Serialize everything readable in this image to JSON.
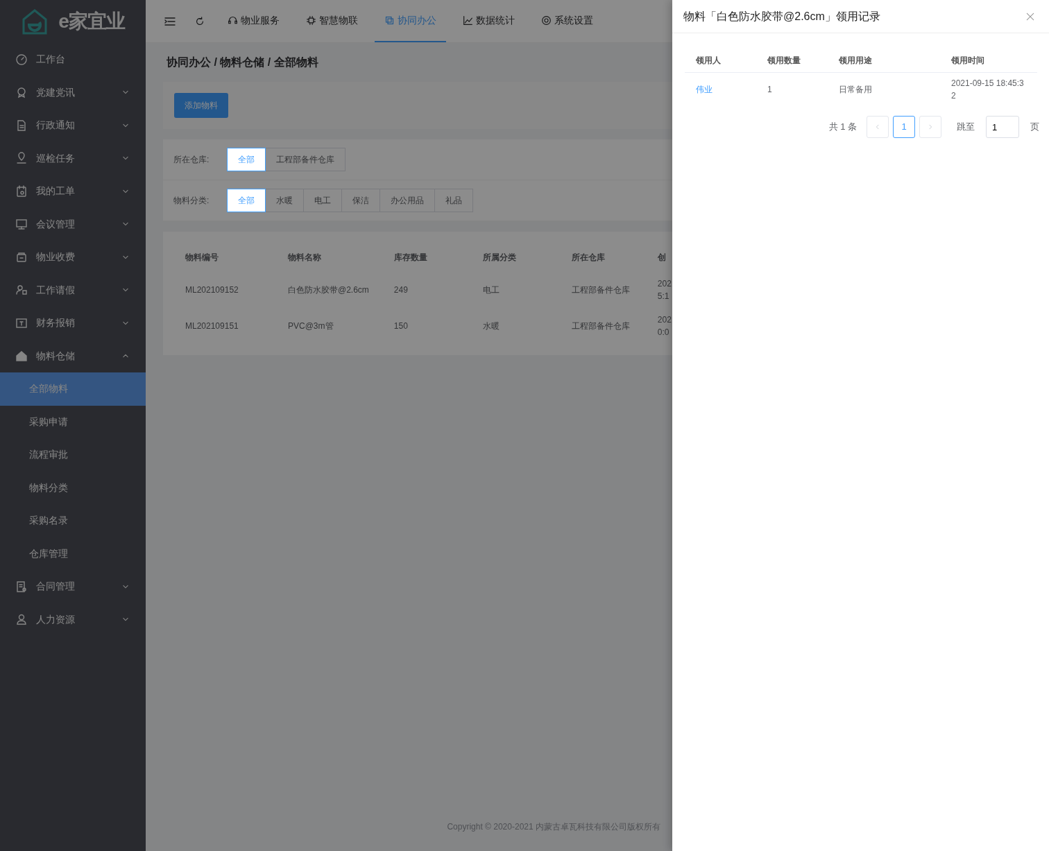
{
  "logo": {
    "text": "e家宜业"
  },
  "top_tabs": [
    {
      "label": "物业服务",
      "selected": false
    },
    {
      "label": "智慧物联",
      "selected": false
    },
    {
      "label": "协同办公",
      "selected": true
    },
    {
      "label": "数据统计",
      "selected": false
    },
    {
      "label": "系统设置",
      "selected": false
    }
  ],
  "sidebar": {
    "items": [
      {
        "label": "工作台",
        "kind": "link"
      },
      {
        "label": "党建党讯",
        "kind": "group",
        "expanded": false
      },
      {
        "label": "行政通知",
        "kind": "group",
        "expanded": false
      },
      {
        "label": "巡检任务",
        "kind": "group",
        "expanded": false
      },
      {
        "label": "我的工单",
        "kind": "group",
        "expanded": false
      },
      {
        "label": "会议管理",
        "kind": "group",
        "expanded": false
      },
      {
        "label": "物业收费",
        "kind": "group",
        "expanded": false
      },
      {
        "label": "工作请假",
        "kind": "group",
        "expanded": false
      },
      {
        "label": "财务报销",
        "kind": "group",
        "expanded": false
      },
      {
        "label": "物料仓储",
        "kind": "group",
        "expanded": true,
        "children": [
          {
            "label": "全部物料",
            "selected": true
          },
          {
            "label": "采购申请",
            "selected": false
          },
          {
            "label": "流程审批",
            "selected": false
          },
          {
            "label": "物料分类",
            "selected": false
          },
          {
            "label": "采购名录",
            "selected": false
          },
          {
            "label": "仓库管理",
            "selected": false
          }
        ]
      },
      {
        "label": "合同管理",
        "kind": "group",
        "expanded": false
      },
      {
        "label": "人力资源",
        "kind": "group",
        "expanded": false
      }
    ]
  },
  "breadcrumb": "协同办公 / 物料仓储 / 全部物料",
  "add_button": "添加物料",
  "filters": [
    {
      "label": "所在仓库:",
      "options": [
        {
          "label": "全部",
          "selected": true
        },
        {
          "label": "工程部备件仓库",
          "selected": false
        }
      ]
    },
    {
      "label": "物料分类:",
      "options": [
        {
          "label": "全部",
          "selected": true
        },
        {
          "label": "水暖",
          "selected": false
        },
        {
          "label": "电工",
          "selected": false
        },
        {
          "label": "保洁",
          "selected": false
        },
        {
          "label": "办公用品",
          "selected": false
        },
        {
          "label": "礼品",
          "selected": false
        }
      ]
    }
  ],
  "table": {
    "columns": [
      "物料编号",
      "物料名称",
      "库存数量",
      "所属分类",
      "所在仓库",
      "创"
    ],
    "rows": [
      [
        "ML202109152",
        "白色防水胶带@2.6cm",
        "249",
        "电工",
        "工程部备件仓库",
        "202\n5:1"
      ],
      [
        "ML202109151",
        "PVC@3m管",
        "150",
        "水暖",
        "工程部备件仓库",
        "202\n0:0"
      ]
    ]
  },
  "footer": "Copyright © 2020-2021 内蒙古卓瓦科技有限公司版权所有",
  "drawer": {
    "title": "物料「白色防水胶带@2.6cm」领用记录",
    "table": {
      "columns": [
        "领用人",
        "领用数量",
        "领用用途",
        "领用时间"
      ],
      "rows": [
        [
          "伟业",
          "1",
          "日常备用",
          "2021-09-15 18:45:3\n2"
        ]
      ]
    },
    "pagination": {
      "total": "共 1 条",
      "pages": [
        {
          "label": "1",
          "selected": true
        }
      ],
      "jump_label": "跳至",
      "jump_value": "1",
      "page_unit": "页"
    }
  }
}
